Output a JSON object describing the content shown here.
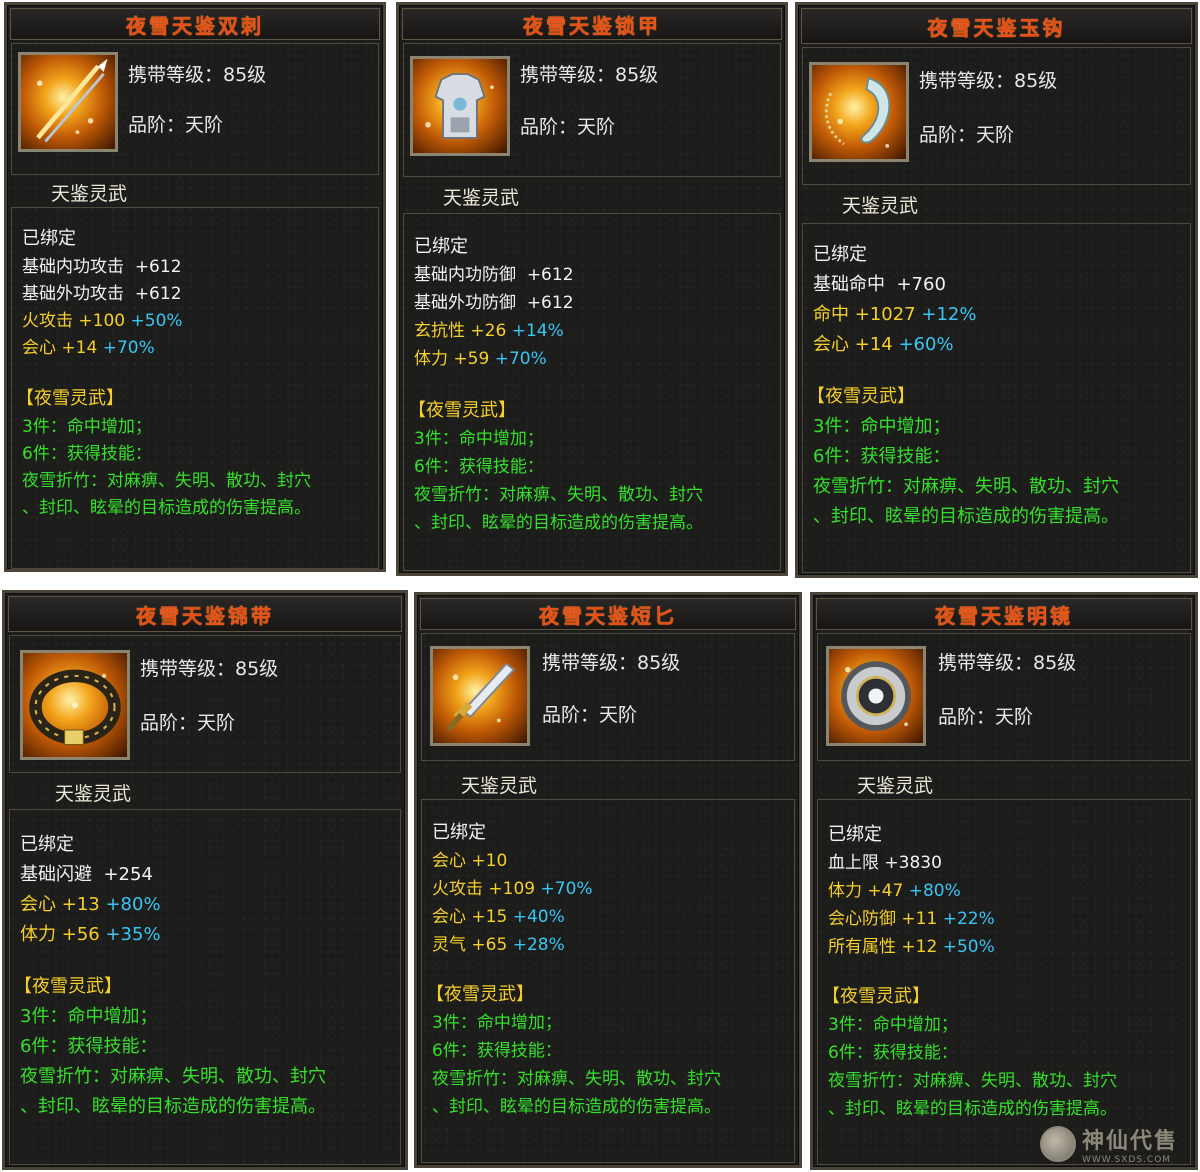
{
  "cards": [
    {
      "title": "夜雪天鉴双刺",
      "level": "携带等级：85级",
      "grade": "品阶：天阶",
      "subtype": "天鉴灵武",
      "bound": "已绑定",
      "stats": [
        {
          "name": "基础内功攻击",
          "value": "+612",
          "pct": ""
        },
        {
          "name": "基础外功攻击",
          "value": "+612",
          "pct": ""
        },
        {
          "name": "火攻击",
          "value": "+100",
          "pct": "+50%",
          "color": "yellow"
        },
        {
          "name": "会心",
          "value": "+14",
          "pct": "+70%",
          "color": "yellow"
        }
      ],
      "set_name": "【夜雪灵武】",
      "set_3": "3件：命中增加；",
      "set_6": "6件：获得技能：",
      "skill_line1": "夜雪折竹：对麻痹、失明、散功、封穴",
      "skill_line2": "、封印、眩晕的目标造成的伤害提高。",
      "icon": "twin-spear-icon"
    },
    {
      "title": "夜雪天鉴锁甲",
      "level": "携带等级：85级",
      "grade": "品阶：天阶",
      "subtype": "天鉴灵武",
      "bound": "已绑定",
      "stats": [
        {
          "name": "基础内功防御",
          "value": "+612",
          "pct": ""
        },
        {
          "name": "基础外功防御",
          "value": "+612",
          "pct": ""
        },
        {
          "name": "玄抗性",
          "value": "+26",
          "pct": "+14%",
          "color": "yellow"
        },
        {
          "name": "体力",
          "value": "+59",
          "pct": "+70%",
          "color": "yellow"
        }
      ],
      "set_name": "【夜雪灵武】",
      "set_3": "3件：命中增加；",
      "set_6": "6件：获得技能：",
      "skill_line1": "夜雪折竹：对麻痹、失明、散功、封穴",
      "skill_line2": "、封印、眩晕的目标造成的伤害提高。",
      "icon": "armor-icon"
    },
    {
      "title": "夜雪天鉴玉钩",
      "level": "携带等级：85级",
      "grade": "品阶：天阶",
      "subtype": "天鉴灵武",
      "bound": "已绑定",
      "stats": [
        {
          "name": "基础命中",
          "value": "+760",
          "pct": ""
        },
        {
          "name": "命中",
          "value": "+1027",
          "pct": "+12%",
          "color": "yellow"
        },
        {
          "name": "会心",
          "value": "+14",
          "pct": "+60%",
          "color": "yellow"
        }
      ],
      "set_name": "【夜雪灵武】",
      "set_3": "3件：命中增加；",
      "set_6": "6件：获得技能：",
      "skill_line1": "夜雪折竹：对麻痹、失明、散功、封穴",
      "skill_line2": "、封印、眩晕的目标造成的伤害提高。",
      "icon": "jade-hook-icon"
    },
    {
      "title": "夜雪天鉴锦带",
      "level": "携带等级：85级",
      "grade": "品阶：天阶",
      "subtype": "天鉴灵武",
      "bound": "已绑定",
      "stats": [
        {
          "name": "基础闪避",
          "value": "+254",
          "pct": ""
        },
        {
          "name": "会心",
          "value": "+13",
          "pct": "+80%",
          "color": "yellow"
        },
        {
          "name": "体力",
          "value": "+56",
          "pct": "+35%",
          "color": "yellow"
        }
      ],
      "set_name": "【夜雪灵武】",
      "set_3": "3件：命中增加；",
      "set_6": "6件：获得技能：",
      "skill_line1": "夜雪折竹：对麻痹、失明、散功、封穴",
      "skill_line2": "、封印、眩晕的目标造成的伤害提高。",
      "icon": "belt-icon"
    },
    {
      "title": "夜雪天鉴短匕",
      "level": "携带等级：85级",
      "grade": "品阶：天阶",
      "subtype": "天鉴灵武",
      "bound": "已绑定",
      "stats": [
        {
          "name": "会心",
          "value": "+10",
          "pct": ""
        },
        {
          "name": "火攻击",
          "value": "+109",
          "pct": "+70%",
          "color": "yellow"
        },
        {
          "name": "会心",
          "value": "+15",
          "pct": "+40%",
          "color": "yellow"
        },
        {
          "name": "灵气",
          "value": "+65",
          "pct": "+28%",
          "color": "yellow"
        }
      ],
      "set_name": "【夜雪灵武】",
      "set_3": "3件：命中增加；",
      "set_6": "6件：获得技能：",
      "skill_line1": "夜雪折竹：对麻痹、失明、散功、封穴",
      "skill_line2": "、封印、眩晕的目标造成的伤害提高。",
      "icon": "dagger-icon"
    },
    {
      "title": "夜雪天鉴明镜",
      "level": "携带等级：85级",
      "grade": "品阶：天阶",
      "subtype": "天鉴灵武",
      "bound": "已绑定",
      "stats": [
        {
          "name": "血上限",
          "value": "+3830",
          "pct": ""
        },
        {
          "name": "体力",
          "value": "+47",
          "pct": "+80%",
          "color": "yellow"
        },
        {
          "name": "会心防御",
          "value": "+11",
          "pct": "+22%",
          "color": "yellow"
        },
        {
          "name": "所有属性",
          "value": "+12",
          "pct": "+50%",
          "color": "yellow"
        }
      ],
      "set_name": "【夜雪灵武】",
      "set_3": "3件：命中增加；",
      "set_6": "6件：获得技能：",
      "skill_line1": "夜雪折竹：对麻痹、失明、散功、封穴",
      "skill_line2": "、封印、眩晕的目标造成的伤害提高。",
      "icon": "mirror-icon"
    }
  ],
  "watermark": {
    "main": "神仙代售",
    "url": "WWW.SXDS.COM"
  },
  "colors": {
    "title": "#e84f17",
    "yellow": "#f5cf2a",
    "cyan": "#38c6f5",
    "green": "#35e02a",
    "white": "#f2f2f2"
  }
}
